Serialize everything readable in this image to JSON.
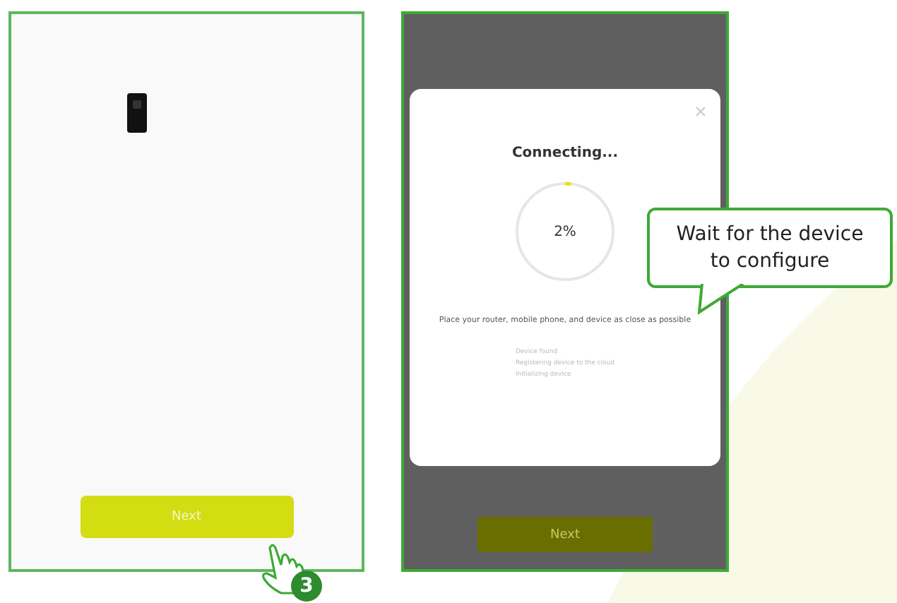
{
  "left_screen": {
    "next_button": "Next"
  },
  "right_screen": {
    "dialog": {
      "title": "Connecting...",
      "progress": {
        "level": 0.02,
        "reading": "2%"
      },
      "hint": "Place your router, mobile phone, and device as close as possible",
      "steps": [
        "Device found",
        "Registering device to the cloud",
        "Initializing device"
      ]
    },
    "next_button": "Next"
  },
  "callout": "Wait for the device to configure",
  "step_badge": "3"
}
